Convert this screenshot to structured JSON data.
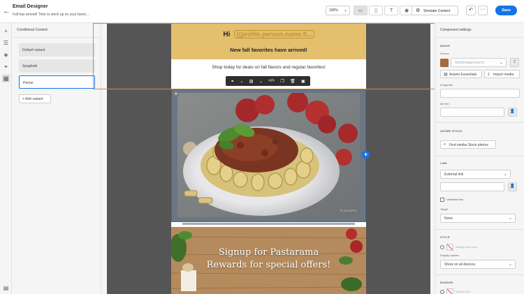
{
  "header": {
    "title": "Email Designer",
    "subtitle": "Fall has arrived! Time to stock up on your favori...",
    "zoom": "100%",
    "simulate_label": "Simulate Content",
    "save_label": "Save"
  },
  "conditional_panel": {
    "title": "Conditional Content",
    "variants": [
      "Default variant",
      "Spaghetti",
      "Penne"
    ],
    "selected_variant": "Penne",
    "add_variant_label": "Add variant"
  },
  "email": {
    "hi_text": "Hi",
    "token": "{{profile.person.name.fi...",
    "headline": "New fall favorites have arrived!",
    "shop_text": "Shop today for deals on fall flavors and regular favorites!",
    "image_credit": "PLANTASTIC",
    "banner_line1": "Signup for Pastarama",
    "banner_line2": "Rewards for special offers!"
  },
  "settings": {
    "title": "Component settings",
    "image_section": "IMAGE",
    "source_label": "Source",
    "source_placeholder": "/blob/image/source",
    "assets_label": "Assets Essentials",
    "import_label": "Import media",
    "image_title_label": "Image title",
    "alt_text_label": "Alt text",
    "adobe_stock_section": "ADOBE STOCK",
    "find_similar_label": "Find similar Stock photos",
    "link_section": "LINK",
    "link_type": "External link",
    "underline_label": "Underline link",
    "target_label": "Target",
    "target_value": "None",
    "style_section": "STYLE",
    "bg_color_label": "Background color",
    "display_options_label": "Display options",
    "display_value": "Show on all devices",
    "border_section": "BORDER",
    "border_label": "Border color"
  }
}
